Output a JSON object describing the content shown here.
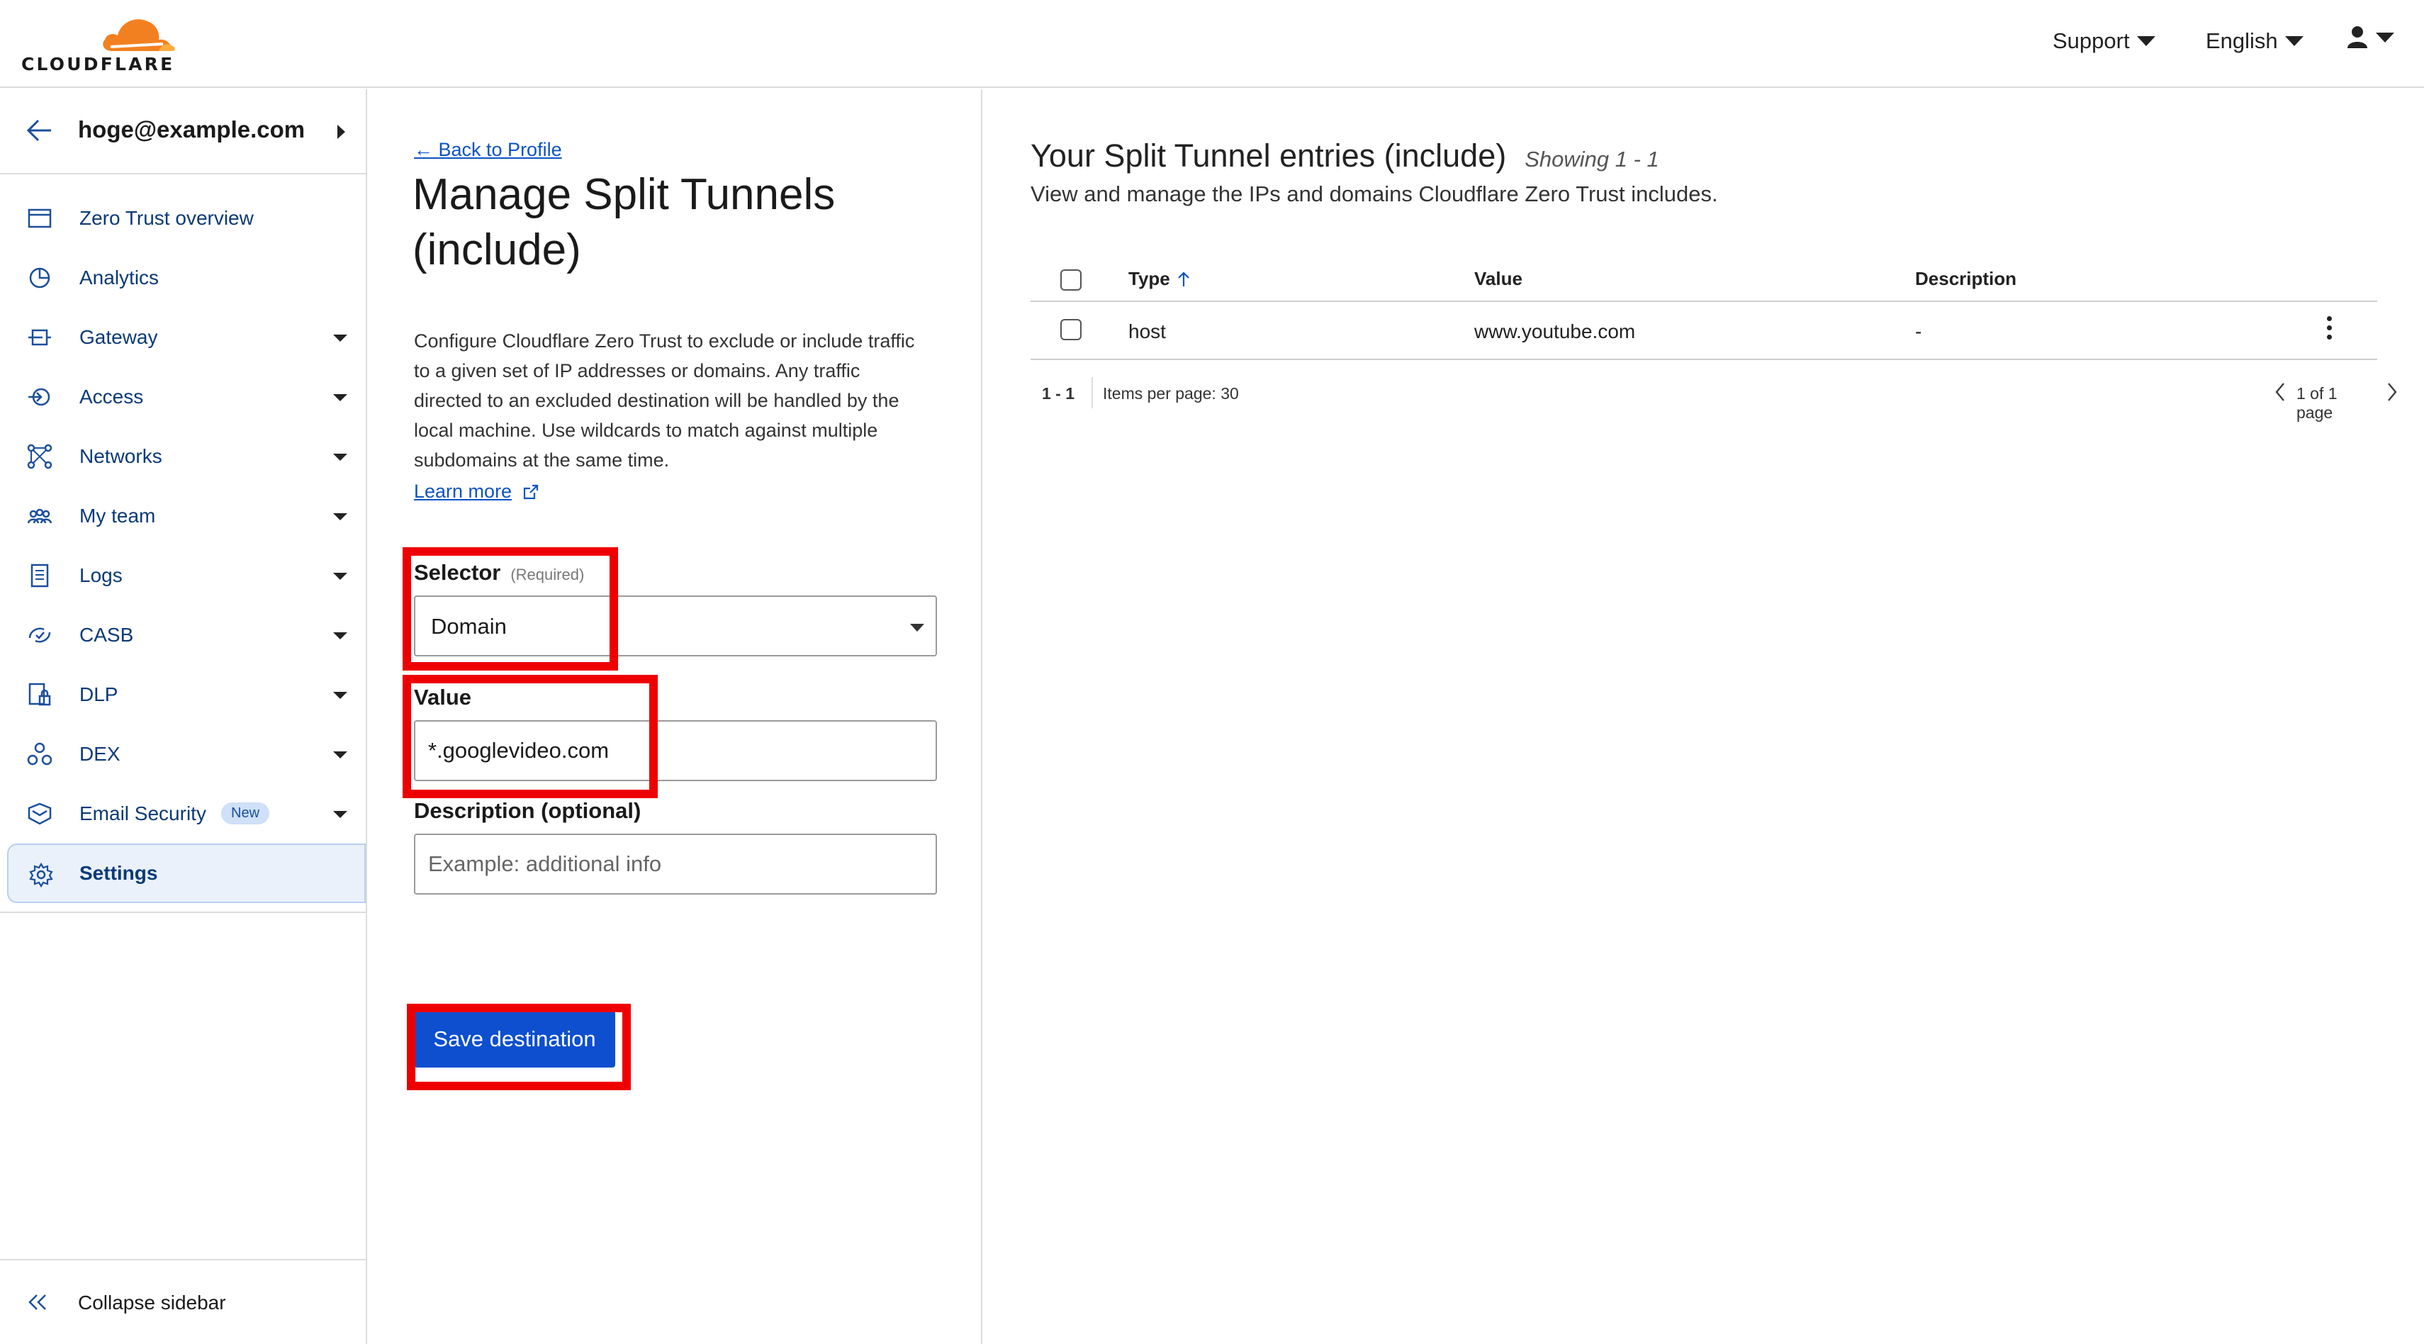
{
  "brand": {
    "logo_text": "CLOUDFLARE",
    "orange": "#f38020",
    "light_orange": "#faad3f"
  },
  "topbar": {
    "support_label": "Support",
    "language_label": "English",
    "user_icon": "user-icon"
  },
  "sidebar": {
    "account_email": "hoge@example.com",
    "items": [
      {
        "label": "Zero Trust overview",
        "icon": "overview-icon",
        "has_dropdown": false
      },
      {
        "label": "Analytics",
        "icon": "analytics-icon",
        "has_dropdown": false
      },
      {
        "label": "Gateway",
        "icon": "gateway-icon",
        "has_dropdown": true
      },
      {
        "label": "Access",
        "icon": "access-icon",
        "has_dropdown": true
      },
      {
        "label": "Networks",
        "icon": "networks-icon",
        "has_dropdown": true
      },
      {
        "label": "My team",
        "icon": "team-icon",
        "has_dropdown": true
      },
      {
        "label": "Logs",
        "icon": "logs-icon",
        "has_dropdown": true
      },
      {
        "label": "CASB",
        "icon": "casb-icon",
        "has_dropdown": true
      },
      {
        "label": "DLP",
        "icon": "dlp-icon",
        "has_dropdown": true
      },
      {
        "label": "DEX",
        "icon": "dex-icon",
        "has_dropdown": true
      },
      {
        "label": "Email Security",
        "icon": "email-security-icon",
        "has_dropdown": true,
        "badge": "New"
      },
      {
        "label": "Settings",
        "icon": "gear-icon",
        "has_dropdown": false,
        "active": true
      }
    ],
    "collapse_label": "Collapse sidebar"
  },
  "form": {
    "back_link": "Back to Profile",
    "title": "Manage Split Tunnels (include)",
    "intro": "Configure Cloudflare Zero Trust to exclude or include traffic to a given set of IP addresses or domains. Any traffic directed to an excluded destination will be handled by the local machine. Use wildcards to match against multiple subdomains at the same time.",
    "learn_more": "Learn more",
    "selector_label": "Selector",
    "selector_required": "(Required)",
    "selector_value": "Domain",
    "value_label": "Value",
    "value_value": "*.googlevideo.com",
    "description_label": "Description (optional)",
    "description_placeholder": "Example: additional info",
    "save_label": "Save destination"
  },
  "list": {
    "title": "Your Split Tunnel entries (include)",
    "showing": "Showing 1 - 1",
    "subtitle": "View and manage the IPs and domains Cloudflare Zero Trust includes.",
    "columns": [
      "Type",
      "Value",
      "Description"
    ],
    "rows": [
      {
        "type": "host",
        "value": "www.youtube.com",
        "description": "-"
      }
    ],
    "pager": {
      "range": "1 - 1",
      "items_per_page": "Items per page: 30",
      "page_info": "1 of 1 page"
    }
  },
  "highlight_color": "#ee0000",
  "accent": "#0d4fcf"
}
